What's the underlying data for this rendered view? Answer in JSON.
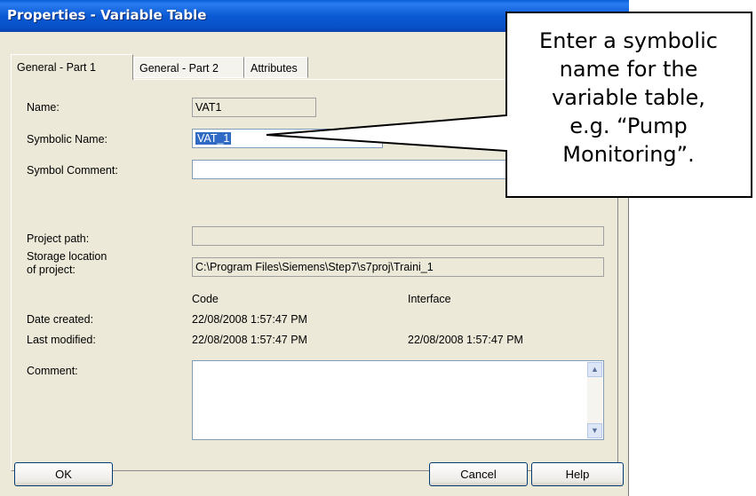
{
  "window": {
    "title": "Properties - Variable Table"
  },
  "tabs": [
    {
      "label": "General - Part 1"
    },
    {
      "label": "General - Part 2"
    },
    {
      "label": "Attributes"
    }
  ],
  "fields": {
    "name": {
      "label": "Name:",
      "value": "VAT1"
    },
    "symbolic_name": {
      "label": "Symbolic Name:",
      "value": "VAT_1"
    },
    "symbol_comment": {
      "label": "Symbol Comment:",
      "value": ""
    },
    "project_path": {
      "label": "Project path:",
      "value": ""
    },
    "storage_location": {
      "label_line1": "Storage location",
      "label_line2": "of project:",
      "value": "C:\\Program Files\\Siemens\\Step7\\s7proj\\Traini_1"
    },
    "comment": {
      "label": "Comment:",
      "value": ""
    }
  },
  "dates": {
    "col_code": "Code",
    "col_interface": "Interface",
    "created_label": "Date created:",
    "created_code": "22/08/2008  1:57:47 PM",
    "modified_label": "Last modified:",
    "modified_code": "22/08/2008  1:57:47 PM",
    "modified_interface": "22/08/2008  1:57:47 PM"
  },
  "buttons": {
    "ok": "OK",
    "cancel": "Cancel",
    "help": "Help"
  },
  "callout": {
    "line1": "Enter a symbolic",
    "line2": "name for the",
    "line3": "variable table,",
    "line4": "e.g. “Pump",
    "line5": "Monitoring”."
  },
  "colors": {
    "titlebar": "#0a5ad4",
    "dialog_bg": "#ece9d8",
    "selection": "#316ac5"
  }
}
